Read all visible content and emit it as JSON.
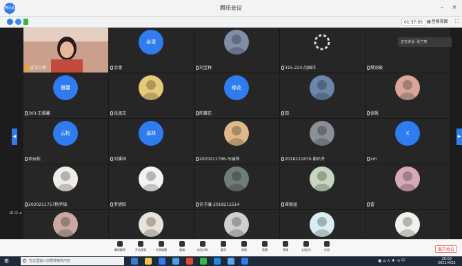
{
  "window": {
    "logo_text": "腾讯会议",
    "title": "腾讯会议",
    "minimize": "–",
    "close": "×"
  },
  "infobar": {
    "timer": "01:37:05",
    "view_label": "宫格视图",
    "view_glyph": "▦",
    "fullscreen_glyph": "⛶"
  },
  "speaker_notice": "正在讲话: 张兰燕",
  "participants": [
    {
      "name": "张兰燕",
      "host": true,
      "type": "video"
    },
    {
      "name": "余濛",
      "type": "initials",
      "initials": "余濛",
      "color": "#2f7bf0"
    },
    {
      "name": "刘宝林",
      "type": "photo",
      "color": "#7f8fa8"
    },
    {
      "name": "315-223-闫国洋",
      "type": "loading",
      "color": "#ffffff"
    },
    {
      "name": "樊润峻",
      "type": "blank"
    },
    {
      "name": "303-王雅馨",
      "type": "initials",
      "initials": "雅馨",
      "color": "#2f7bf0"
    },
    {
      "name": "张涵文",
      "type": "photo",
      "color": "#e8c97a"
    },
    {
      "name": "陈蝶花",
      "type": "initials",
      "initials": "蝶花",
      "color": "#2f7bf0"
    },
    {
      "name": "田",
      "type": "photo",
      "color": "#6b86a8"
    },
    {
      "name": "张帆",
      "type": "photo",
      "color": "#d9a59a"
    },
    {
      "name": "项云松",
      "type": "initials",
      "initials": "云松",
      "color": "#2f7bf0"
    },
    {
      "name": "刘溪林",
      "type": "initials",
      "initials": "溪林",
      "color": "#2f7bf0"
    },
    {
      "name": "2020211796-马瑞祥",
      "type": "photo",
      "color": "#e0b98a"
    },
    {
      "name": "2018211870-谢正升",
      "type": "photo",
      "color": "#8a8f98"
    },
    {
      "name": "xm",
      "type": "initials",
      "initials": "X",
      "color": "#2f7bf0"
    },
    {
      "name": "2020211757杨李韬",
      "type": "photo",
      "color": "#f0ede8"
    },
    {
      "name": "罗旭阳",
      "type": "photo",
      "color": "#f4f4f4"
    },
    {
      "name": "许子康-2018211514",
      "type": "photo",
      "color": "#6f7d7a"
    },
    {
      "name": "崔丽涵",
      "type": "photo",
      "color": "#c7d6c0"
    },
    {
      "name": "雷",
      "type": "photo",
      "color": "#d6a8b8"
    },
    {
      "name": "",
      "type": "photo",
      "color": "#c9a8a0"
    },
    {
      "name": "",
      "type": "photo",
      "color": "#e8e2d8"
    },
    {
      "name": "",
      "type": "photo",
      "color": "#cfcfcf"
    },
    {
      "name": "",
      "type": "photo",
      "color": "#d8eef0"
    },
    {
      "name": "",
      "type": "photo",
      "color": "#f2f0ec"
    }
  ],
  "toolbar": {
    "items": [
      {
        "label": "解除静音",
        "icon": "mic-icon"
      },
      {
        "label": "开启视频",
        "icon": "camera-icon"
      },
      {
        "label": "共享屏幕",
        "icon": "share-screen-icon"
      },
      {
        "label": "邀请",
        "icon": "invite-icon"
      },
      {
        "label": "成员(41)",
        "icon": "members-icon"
      },
      {
        "label": "聊天",
        "icon": "chat-icon"
      },
      {
        "label": "录制",
        "icon": "record-icon"
      },
      {
        "label": "直播",
        "icon": "live-icon"
      },
      {
        "label": "表情",
        "icon": "emoji-icon"
      },
      {
        "label": "文档(1)",
        "icon": "doc-icon"
      },
      {
        "label": "应用",
        "icon": "apps-icon"
      }
    ],
    "end_label": "离开会议"
  },
  "taskbar": {
    "search_placeholder": "在这里输入你要搜索的内容",
    "tray": "▣ ⌂ ∧ ♦ ⊲ 中",
    "time": "20:02",
    "date": "2021/4/22",
    "apps": [
      "#3a7bd5",
      "#f5c542",
      "#2f7bf0",
      "#4a9eea",
      "#e8463a",
      "#3bb54a",
      "#1e88e5",
      "#56a8f0",
      "#2f7bf0"
    ]
  },
  "left_tools": "⊞ ⊟ ◂"
}
